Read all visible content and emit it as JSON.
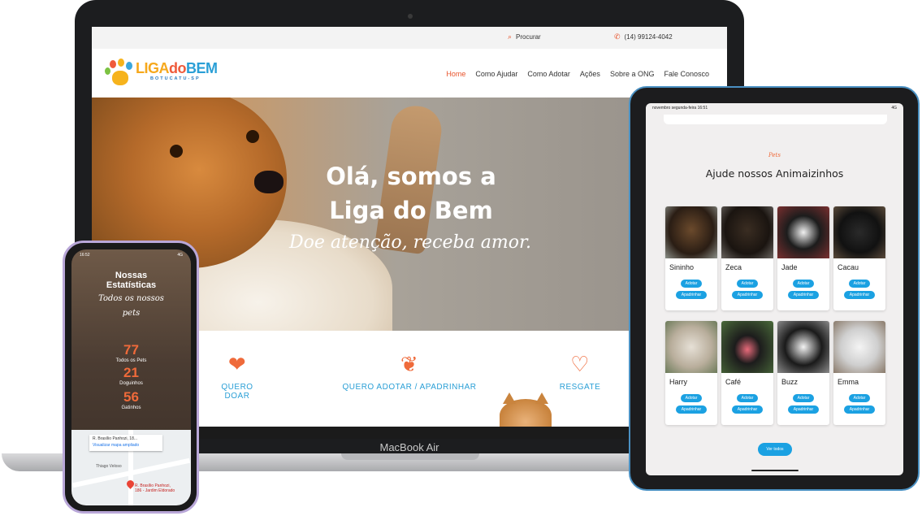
{
  "laptop": {
    "brand": "MacBook Air",
    "site": {
      "topbar": {
        "search_label": "Procurar",
        "phone": "(14) 99124-4042"
      },
      "logo": {
        "word1": "LIGA",
        "word2": "do",
        "word3": "BEM",
        "subtitle": "BOTUCATU-SP"
      },
      "menu": [
        "Home",
        "Como Ajudar",
        "Como Adotar",
        "Ações",
        "Sobre a ONG",
        "Fale Conosco"
      ],
      "hero": {
        "title_line1": "Olá, somos a",
        "title_line2": "Liga do Bem",
        "tagline": "Doe atenção, receba amor."
      },
      "features": [
        "QUERO DOAR",
        "QUERO ADOTAR / APADRINHAR",
        "RESGATE"
      ]
    }
  },
  "phone": {
    "time": "16:52",
    "signal": "4G",
    "title_line1": "Nossas",
    "title_line2": "Estatísticas",
    "script_line1": "Todos os nossos",
    "script_line2": "pets",
    "stats": [
      {
        "value": "77",
        "label": "Todos os Pets"
      },
      {
        "value": "21",
        "label": "Doguinhos"
      },
      {
        "value": "56",
        "label": "Gatinhos"
      }
    ],
    "map": {
      "address_short": "R. Brasílio Panhozi, 18...",
      "link": "Visualizar mapa ampliado",
      "place": "Thiago Veloso",
      "pin_label_line1": "R. Brasílio Panhozi,",
      "pin_label_line2": "186 - Jardim Eldorado"
    }
  },
  "tablet": {
    "status_left": "novembro segunda-feira 16:51",
    "status_right": "4G",
    "script": "Pets",
    "title": "Ajude nossos Animaizinhos",
    "adopt_label": "Adotar",
    "sponsor_label": "Apadrinhar",
    "pets": [
      {
        "name": "Sininho",
        "photo": "dog-black-tan"
      },
      {
        "name": "Zeca",
        "photo": "dog-black"
      },
      {
        "name": "Jade",
        "photo": "cat-black-white"
      },
      {
        "name": "Cacau",
        "photo": "cat-black"
      },
      {
        "name": "Harry",
        "photo": "cat-white-tabby"
      },
      {
        "name": "Café",
        "photo": "dog-black-tongue"
      },
      {
        "name": "Buzz",
        "photo": "cat-black-white-2"
      },
      {
        "name": "Emma",
        "photo": "cat-white-grey"
      }
    ],
    "view_all_label": "Ver todos"
  },
  "colors": {
    "accent": "#e8532b",
    "link_blue": "#2a9fd6",
    "button_blue": "#1ba1e2",
    "logo_text": "#f0a020"
  }
}
